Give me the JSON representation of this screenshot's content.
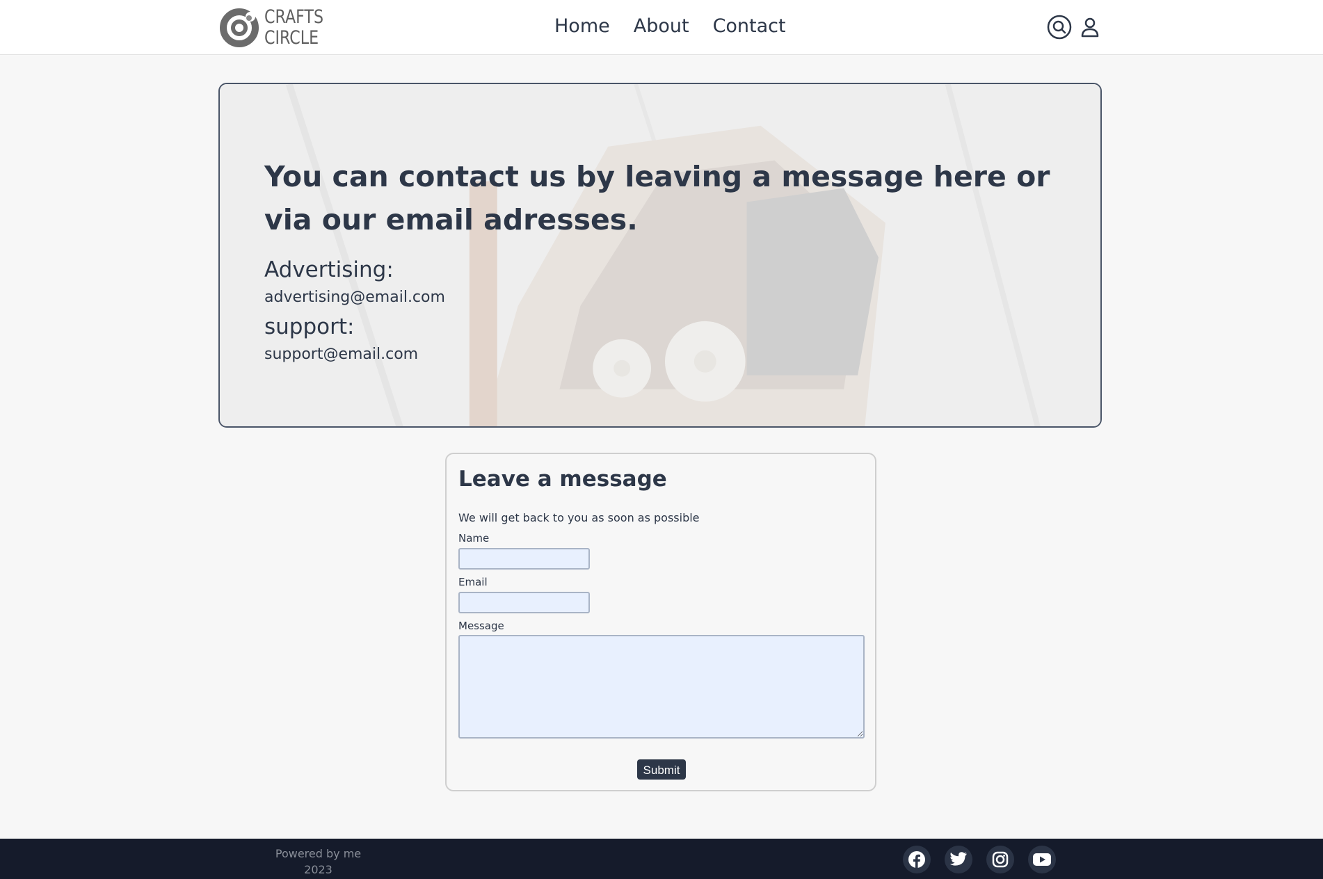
{
  "header": {
    "logo_line1": "CRAFTS",
    "logo_line2": "CIRCLE",
    "nav": [
      "Home",
      "About",
      "Contact"
    ],
    "icons": [
      "search-icon",
      "user-icon"
    ]
  },
  "hero": {
    "title": "You can contact us by leaving a message here or via our email adresses.",
    "advertising_label": "Advertising:",
    "advertising_email": "advertising@email.com",
    "support_label": "support:",
    "support_email": "support@email.com"
  },
  "form": {
    "title": "Leave a message",
    "subtitle": "We will get back to you as soon as possible",
    "name_label": "Name",
    "name_value": "",
    "email_label": "Email",
    "email_value": "",
    "message_label": "Message",
    "message_value": "",
    "submit_label": "Submit"
  },
  "footer": {
    "powered": "Powered by me",
    "year": "2023",
    "social": [
      "facebook-icon",
      "twitter-icon",
      "instagram-icon",
      "youtube-icon"
    ]
  },
  "colors": {
    "primary": "#2d3748",
    "background": "#f7f7f7",
    "footer": "#151b2b",
    "input": "#e8f0fe"
  }
}
